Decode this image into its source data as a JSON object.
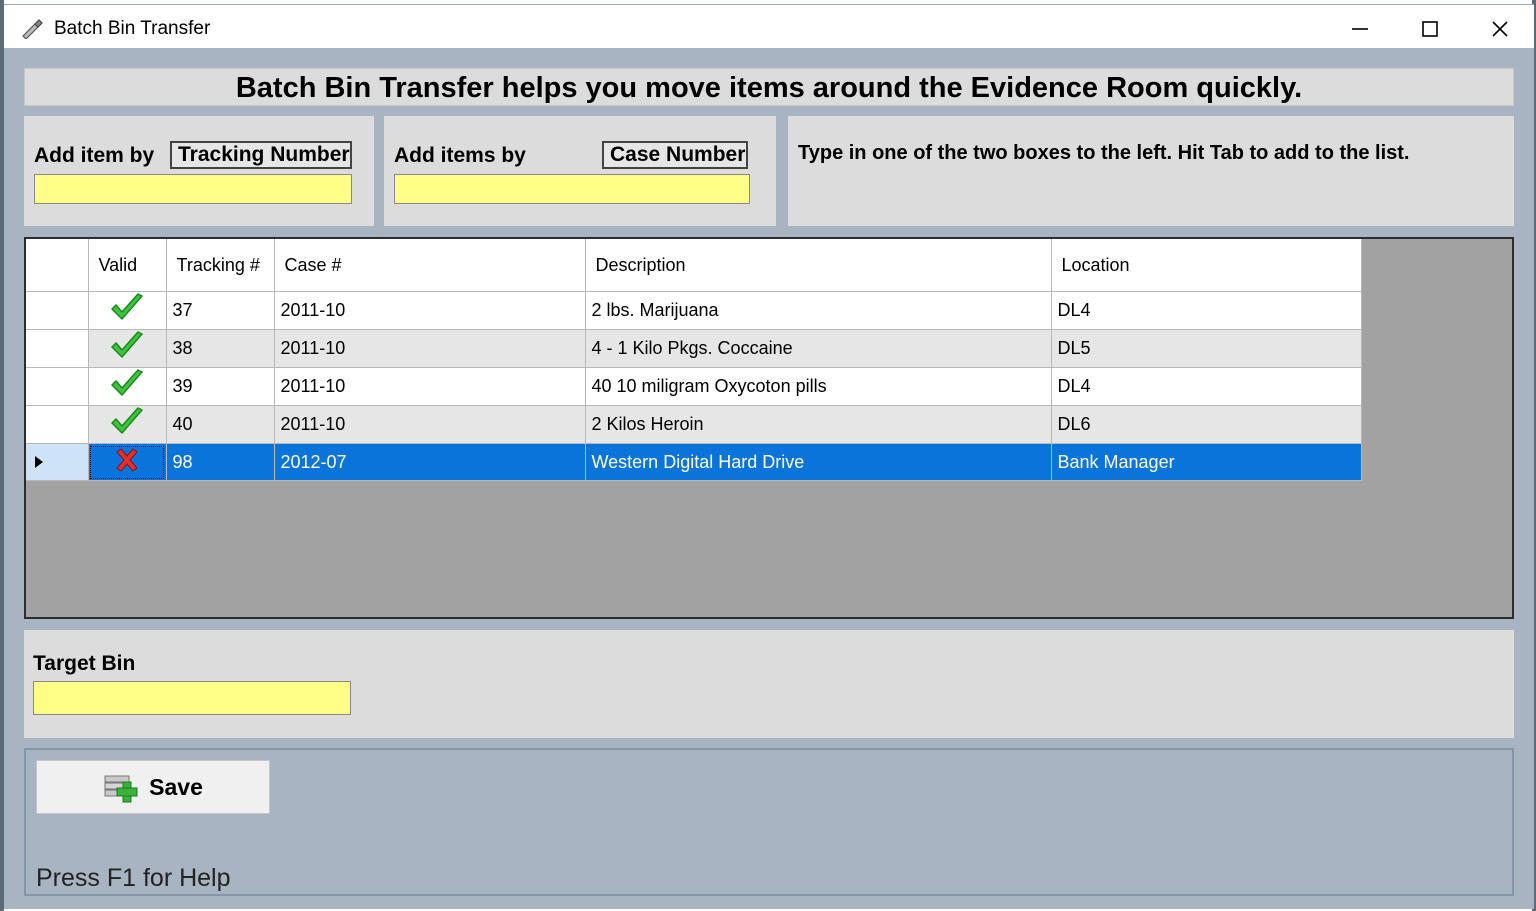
{
  "window": {
    "title": "Batch Bin Transfer"
  },
  "banner": {
    "text": "Batch Bin Transfer helps you move items around the Evidence Room quickly."
  },
  "tracking_panel": {
    "label": "Add item by",
    "combo_value": "Tracking Number",
    "input_value": ""
  },
  "case_panel": {
    "label": "Add items by",
    "combo_value": "Case Number",
    "input_value": ""
  },
  "instructions": {
    "text": "Type in one of the two boxes to the left. Hit Tab to add to the list."
  },
  "grid": {
    "columns": [
      "Valid",
      "Tracking #",
      "Case #",
      "Description",
      "Location"
    ],
    "rows": [
      {
        "valid": true,
        "tracking": "37",
        "case": "2011-10",
        "description": "2 lbs. Marijuana",
        "location": "DL4"
      },
      {
        "valid": true,
        "tracking": "38",
        "case": "2011-10",
        "description": "4 - 1 Kilo Pkgs. Coccaine",
        "location": "DL5"
      },
      {
        "valid": true,
        "tracking": "39",
        "case": "2011-10",
        "description": "40 10 miligram Oxycoton pills",
        "location": "DL4"
      },
      {
        "valid": true,
        "tracking": "40",
        "case": "2011-10",
        "description": "2 Kilos Heroin",
        "location": "DL6"
      },
      {
        "valid": false,
        "tracking": "98",
        "case": "2012-07",
        "description": "Western Digital Hard Drive",
        "location": "Bank Manager"
      }
    ],
    "selected_row": 4
  },
  "target_bin": {
    "label": "Target Bin",
    "input_value": ""
  },
  "save_button": {
    "label": "Save"
  },
  "help_text": "Press F1 for Help",
  "colors": {
    "input_bg": "#ffff88",
    "selection": "#0a74da",
    "client_bg": "#a8b4c2"
  },
  "icons": {
    "valid": "check-icon",
    "invalid": "x-icon",
    "save": "save-add-icon"
  }
}
